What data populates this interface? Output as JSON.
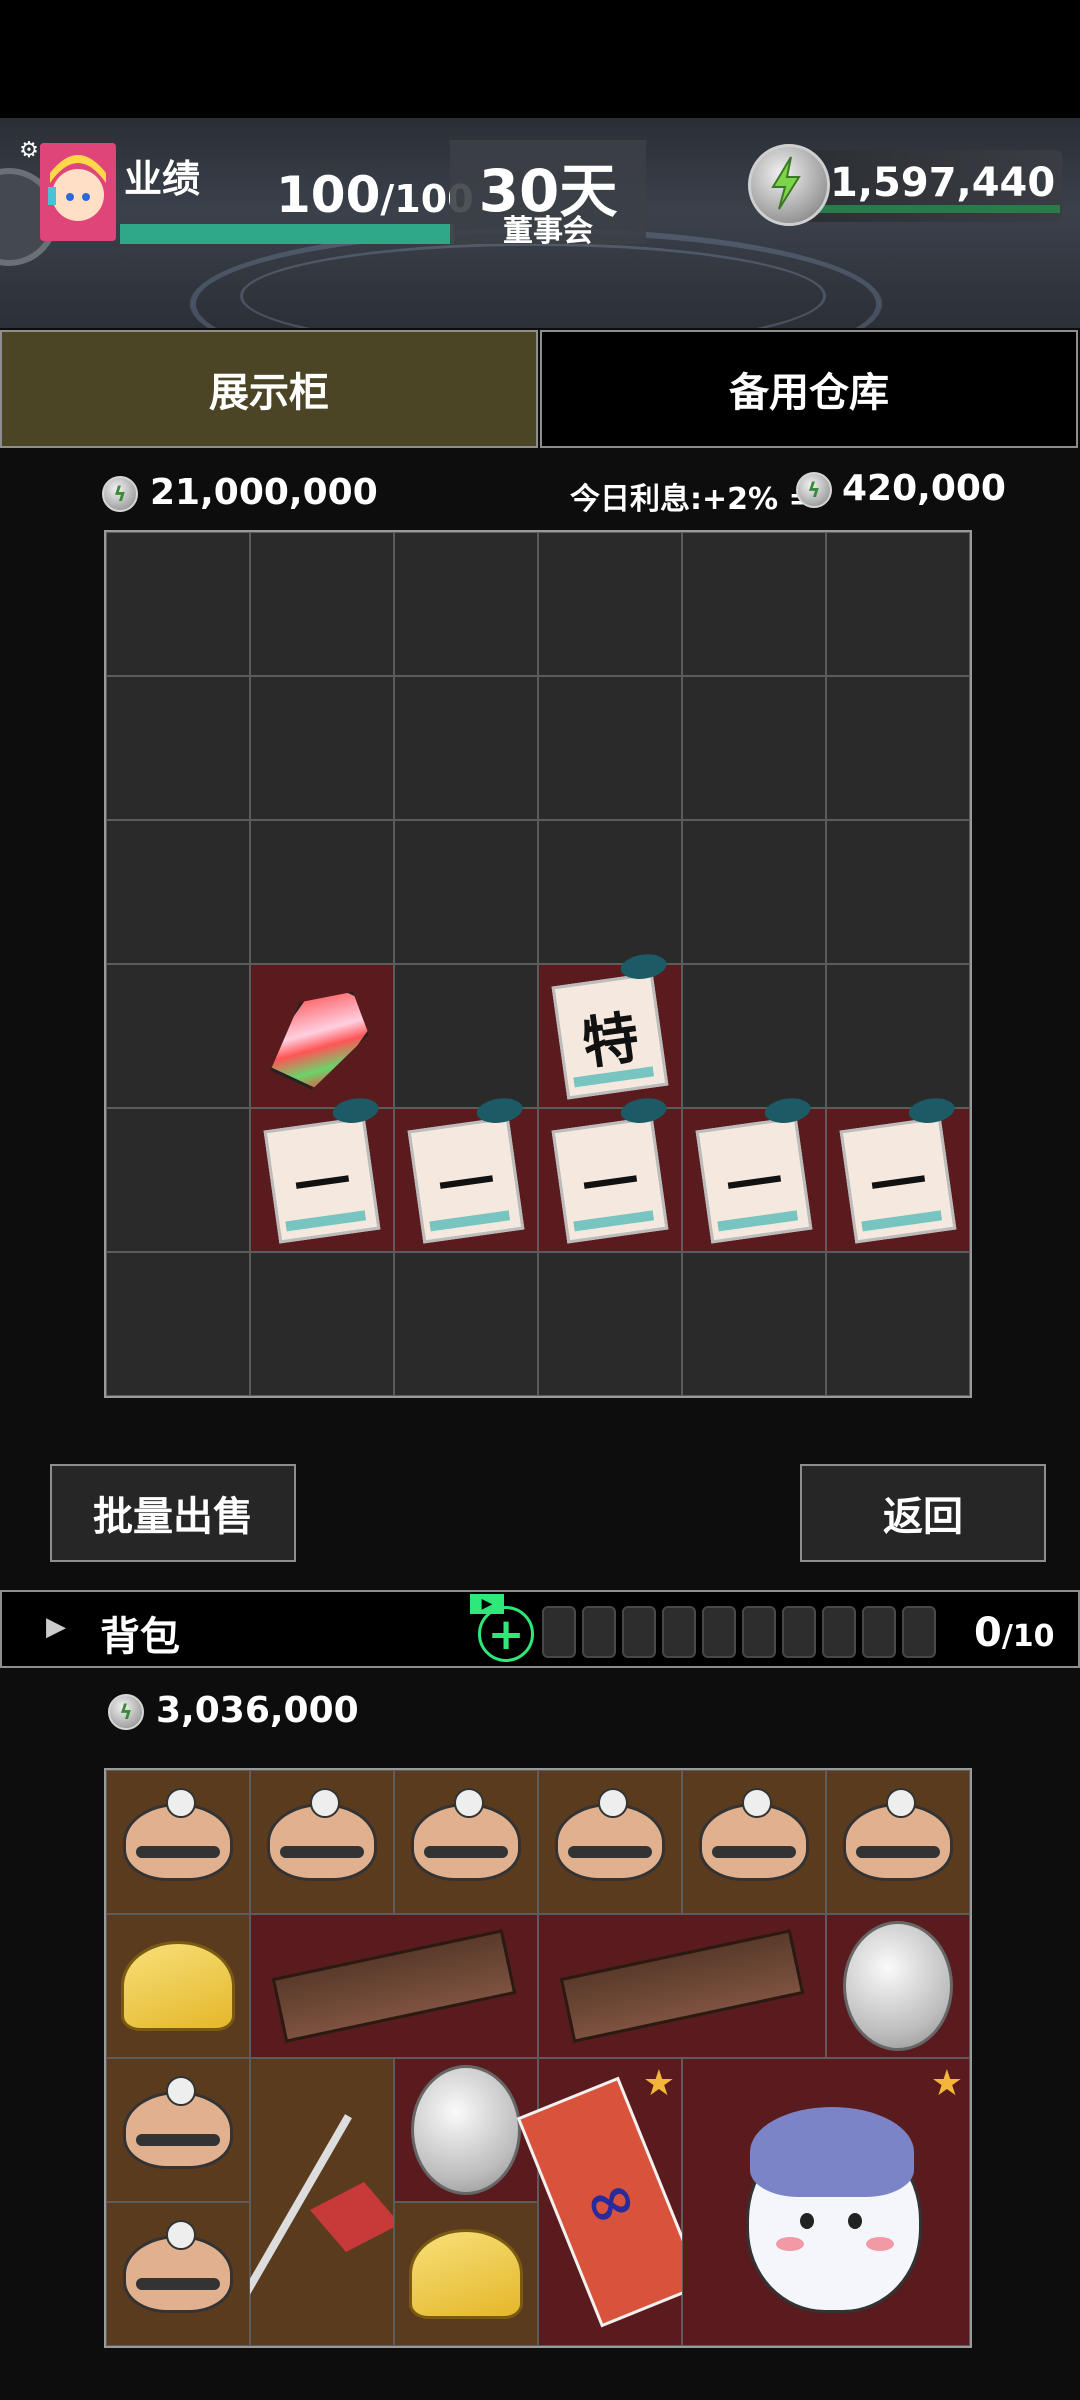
{
  "header": {
    "performance_label": "业绩",
    "performance_current": "100",
    "performance_max": "/100",
    "performance_fraction": 1.0,
    "days_value": "30天",
    "days_label": "董事会",
    "coin_balance": "1,597,440"
  },
  "tabs": [
    {
      "label": "展示柜",
      "active": true
    },
    {
      "label": "备用仓库",
      "active": false
    }
  ],
  "display": {
    "total_value": "21,000,000",
    "interest_label": "今日利息:+2% =",
    "interest_value": "420,000",
    "ticket_special_char": "特",
    "ticket_first_char": "一"
  },
  "buttons": {
    "bulk_sell": "批量出售",
    "back": "返回"
  },
  "backpack": {
    "label": "背包",
    "count_current": "0",
    "count_max": "/10",
    "ad_label": "▶",
    "total_value": "3,036,000"
  },
  "colors": {
    "highlight_cell": "#5a1b1e",
    "active_tab": "#4b4526",
    "progress_fill": "#2fa888",
    "add_button": "#2ee87a",
    "star": "#f2b73a"
  }
}
